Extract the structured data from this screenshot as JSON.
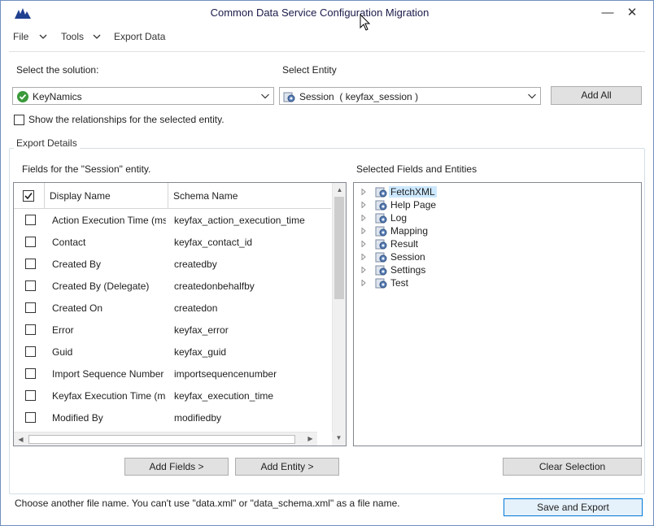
{
  "window": {
    "title": "Common Data Service Configuration Migration",
    "minimize": "—",
    "close": "✕"
  },
  "menu": {
    "file": "File",
    "tools": "Tools",
    "export_data": "Export Data"
  },
  "solution": {
    "label": "Select the solution:",
    "value": "KeyNamics"
  },
  "entity": {
    "label": "Select Entity",
    "value": "Session  ( keyfax_session )"
  },
  "add_all": "Add All",
  "show_relationships": "Show the relationships for the selected entity.",
  "export_details": {
    "title": "Export Details",
    "fields_label": "Fields  for the \"Session\" entity.",
    "selected_label": "Selected Fields and Entities",
    "columns": {
      "display_name": "Display Name",
      "schema_name": "Schema Name"
    },
    "rows": [
      {
        "display": "Action Execution Time (ms)",
        "schema": "keyfax_action_execution_time"
      },
      {
        "display": "Contact",
        "schema": "keyfax_contact_id"
      },
      {
        "display": "Created By",
        "schema": "createdby"
      },
      {
        "display": "Created By (Delegate)",
        "schema": "createdonbehalfby"
      },
      {
        "display": "Created On",
        "schema": "createdon"
      },
      {
        "display": "Error",
        "schema": "keyfax_error"
      },
      {
        "display": "Guid",
        "schema": "keyfax_guid"
      },
      {
        "display": "Import Sequence Number",
        "schema": "importsequencenumber"
      },
      {
        "display": "Keyfax Execution Time (ms)",
        "schema": "keyfax_execution_time"
      },
      {
        "display": "Modified By",
        "schema": "modifiedby"
      }
    ],
    "tree": [
      "FetchXML",
      "Help Page",
      "Log",
      "Mapping",
      "Result",
      "Session",
      "Settings",
      "Test"
    ],
    "tree_selected": "FetchXML",
    "add_fields": "Add Fields >",
    "add_entity": "Add Entity >",
    "clear_selection": "Clear Selection"
  },
  "footer": {
    "message": "Choose another file name. You can't use \"data.xml\" or \"data_schema.xml\" as a file name.",
    "save_export": "Save and Export"
  },
  "colors": {
    "accent": "#0078d7",
    "selection": "#cce8ff",
    "check_green": "#3a9a3a"
  }
}
